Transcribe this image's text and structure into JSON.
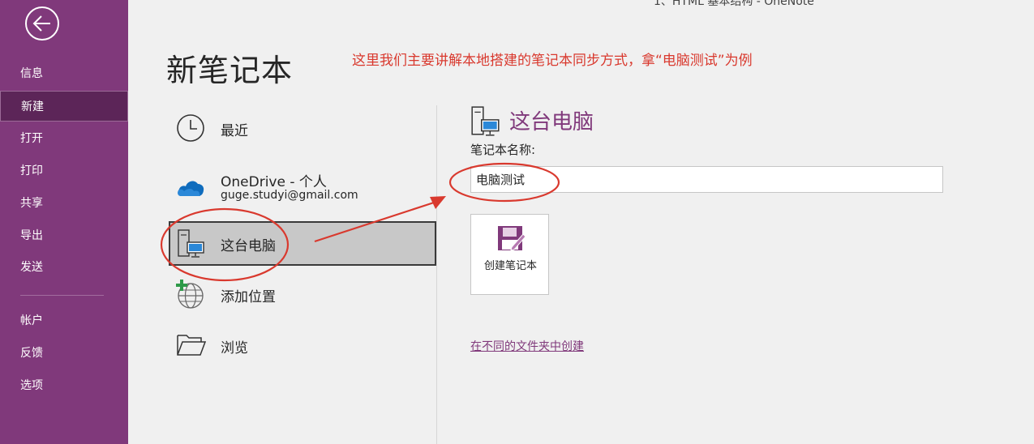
{
  "window_title": "1、HTML 基本结构 - OneNote",
  "sidebar": {
    "items": [
      {
        "label": "信息"
      },
      {
        "label": "新建"
      },
      {
        "label": "打开"
      },
      {
        "label": "打印"
      },
      {
        "label": "共享"
      },
      {
        "label": "导出"
      },
      {
        "label": "发送"
      },
      {
        "label": "帐户"
      },
      {
        "label": "反馈"
      },
      {
        "label": "选项"
      }
    ],
    "active": "新建"
  },
  "page": {
    "title": "新笔记本",
    "annotation": "这里我们主要讲解本地搭建的笔记本同步方式，拿“电脑测试”为例"
  },
  "locations": [
    {
      "label": "最近",
      "icon": "clock-icon"
    },
    {
      "label": "OneDrive - 个人",
      "sub": "guge.studyi@gmail.com",
      "icon": "cloud-icon"
    },
    {
      "label": "这台电脑",
      "icon": "computer-icon",
      "selected": true
    },
    {
      "label": "添加位置",
      "icon": "globe-add-icon"
    },
    {
      "label": "浏览",
      "icon": "folder-icon"
    }
  ],
  "panel": {
    "heading": "这台电脑",
    "name_label": "笔记本名称:",
    "name_value": "电脑测试",
    "create_label": "创建笔记本",
    "folder_link": "在不同的文件夹中创建"
  },
  "colors": {
    "sidebar_bg": "#80397b",
    "accent": "#80397b",
    "annotation": "#d9392e"
  }
}
